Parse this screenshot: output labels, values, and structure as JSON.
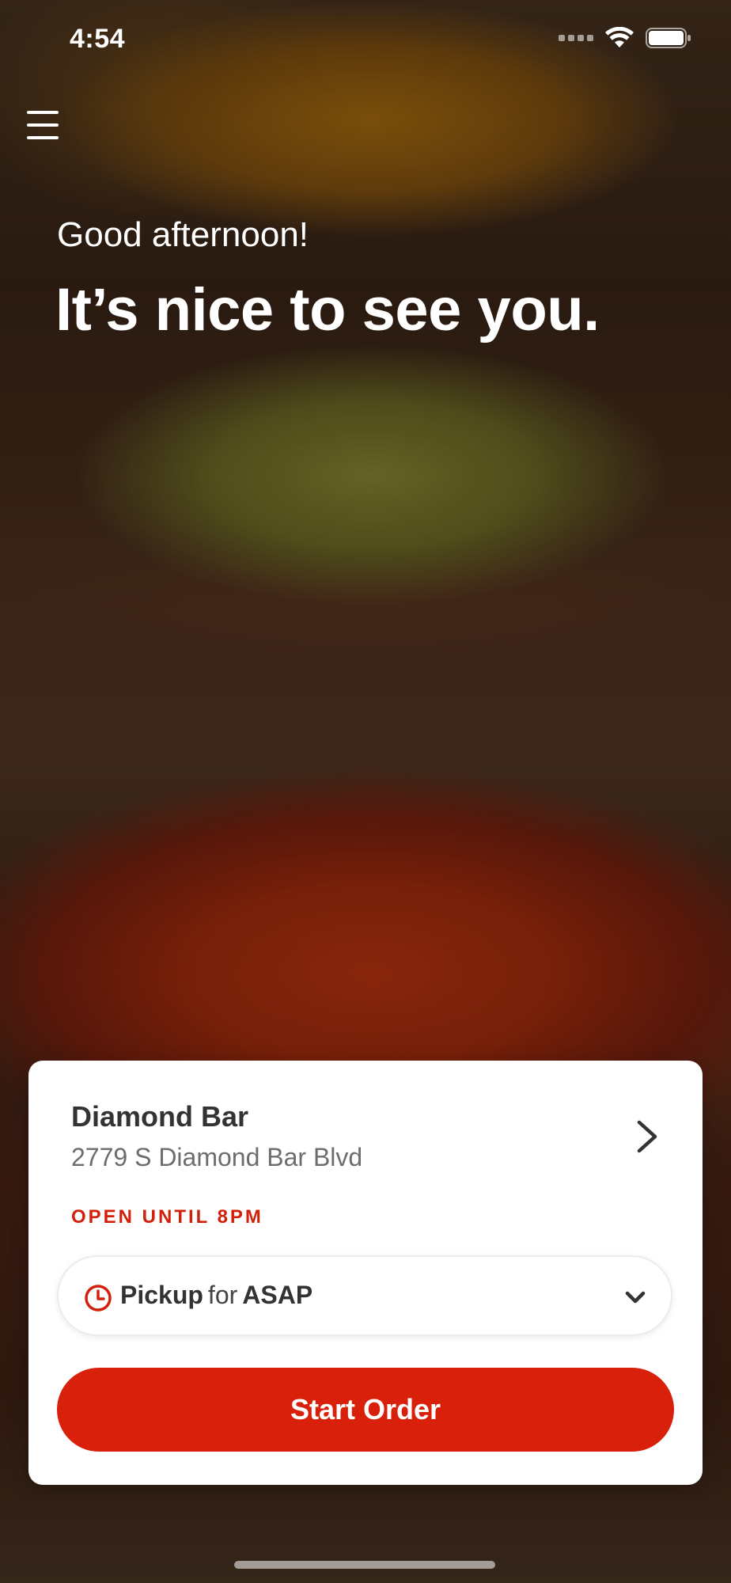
{
  "status_bar": {
    "time": "4:54"
  },
  "menu": {
    "icon": "hamburger-menu-icon"
  },
  "greeting": {
    "salutation": "Good afternoon!",
    "headline": "It’s nice to see you."
  },
  "location": {
    "name": "Diamond Bar",
    "address": "2779 S Diamond Bar Blvd",
    "status": "OPEN UNTIL 8PM"
  },
  "order_mode": {
    "mode": "Pickup",
    "connector": "for",
    "time": "ASAP"
  },
  "actions": {
    "start_order": "Start Order"
  },
  "colors": {
    "accent": "#d9200b",
    "status_red": "#d2200a"
  }
}
